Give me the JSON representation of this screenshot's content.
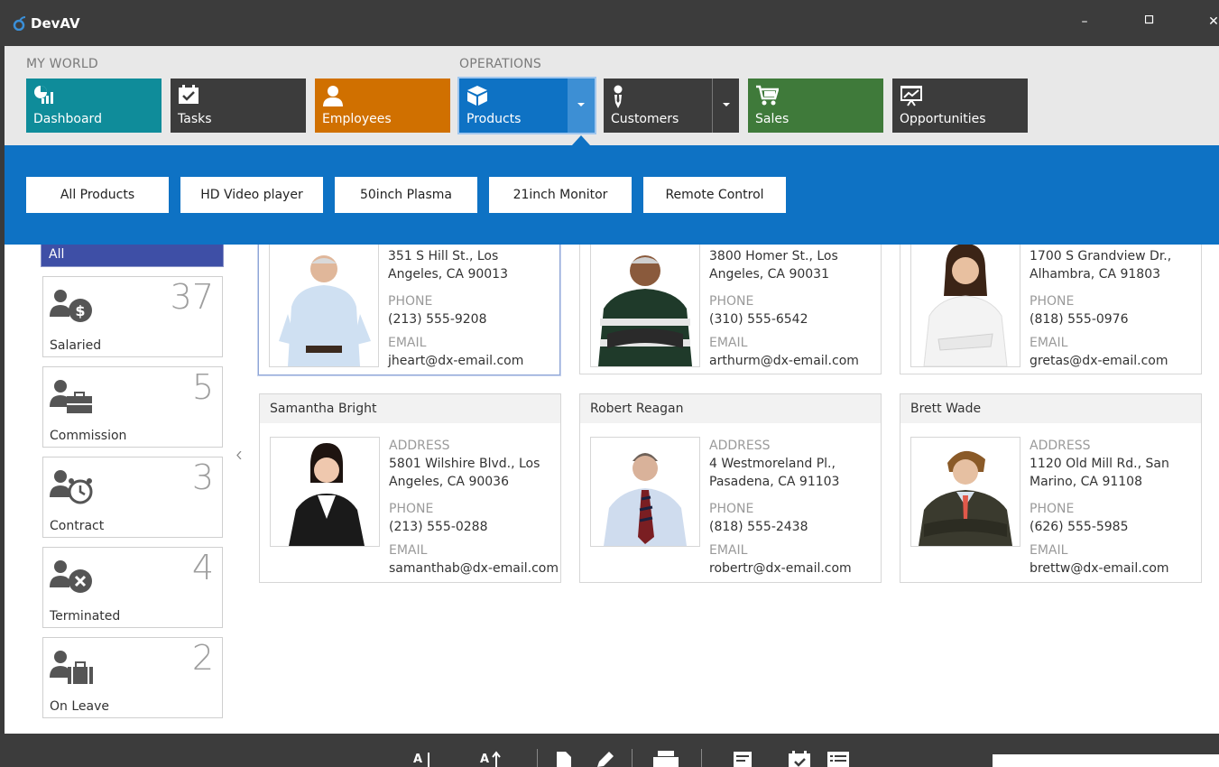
{
  "window": {
    "title": "DevAV",
    "minimize": "–",
    "maximize": "□",
    "close": "✕"
  },
  "nav": {
    "group_my_world": "MY WORLD",
    "group_operations": "OPERATIONS",
    "tiles": [
      {
        "label": "Dashboard",
        "color": "#0f8c9a",
        "icon": "dashboard-icon"
      },
      {
        "label": "Tasks",
        "color": "#3c3c3c",
        "icon": "tasks-icon"
      },
      {
        "label": "Employees",
        "color": "#d07000",
        "icon": "employees-icon"
      },
      {
        "label": "Products",
        "color": "#0e72c4",
        "icon": "products-icon"
      },
      {
        "label": "Customers",
        "color": "#3c3c3c",
        "icon": "customers-icon"
      },
      {
        "label": "Sales",
        "color": "#3f7a3a",
        "icon": "sales-icon"
      },
      {
        "label": "Opportunities",
        "color": "#3c3c3c",
        "icon": "opportunities-icon"
      }
    ]
  },
  "products_menu": [
    "All Products",
    "HD Video player",
    "50inch Plasma",
    "21inch Monitor",
    "Remote Control"
  ],
  "filters": {
    "all": "All",
    "items": [
      {
        "label": "Salaried",
        "count": "37",
        "icon": "salaried-icon"
      },
      {
        "label": "Commission",
        "count": "5",
        "icon": "commission-icon"
      },
      {
        "label": "Contract",
        "count": "3",
        "icon": "contract-icon"
      },
      {
        "label": "Terminated",
        "count": "4",
        "icon": "terminated-icon"
      },
      {
        "label": "On Leave",
        "count": "2",
        "icon": "on-leave-icon"
      }
    ]
  },
  "labels": {
    "address": "ADDRESS",
    "phone": "PHONE",
    "email": "EMAIL"
  },
  "employees": [
    {
      "name": "",
      "address1": "351 S Hill St., Los",
      "address2": "Angeles, CA 90013",
      "phone": "(213) 555-9208",
      "email": "jheart@dx-email.com"
    },
    {
      "name": "",
      "address1": "3800 Homer St., Los",
      "address2": "Angeles, CA 90031",
      "phone": "(310) 555-6542",
      "email": "arthurm@dx-email.com"
    },
    {
      "name": "",
      "address1": "1700 S Grandview Dr.,",
      "address2": "Alhambra, CA 91803",
      "phone": "(818) 555-0976",
      "email": "gretas@dx-email.com"
    },
    {
      "name": "Samantha Bright",
      "address1": "5801 Wilshire Blvd., Los",
      "address2": "Angeles, CA 90036",
      "phone": "(213) 555-0288",
      "email": "samanthab@dx-email.com"
    },
    {
      "name": "Robert Reagan",
      "address1": "4 Westmoreland Pl.,",
      "address2": "Pasadena, CA 91103",
      "phone": "(818) 555-2438",
      "email": "robertr@dx-email.com"
    },
    {
      "name": "Brett Wade",
      "address1": "1120 Old Mill Rd., San",
      "address2": "Marino, CA 91108",
      "phone": "(626) 555-5985",
      "email": "brettw@dx-email.com"
    }
  ],
  "bottom_icons": [
    "sort-ascending-icon",
    "sort-descending-icon",
    "new-document-icon",
    "edit-icon",
    "print-icon",
    "report-icon",
    "calendar-check-icon",
    "list-icon"
  ]
}
